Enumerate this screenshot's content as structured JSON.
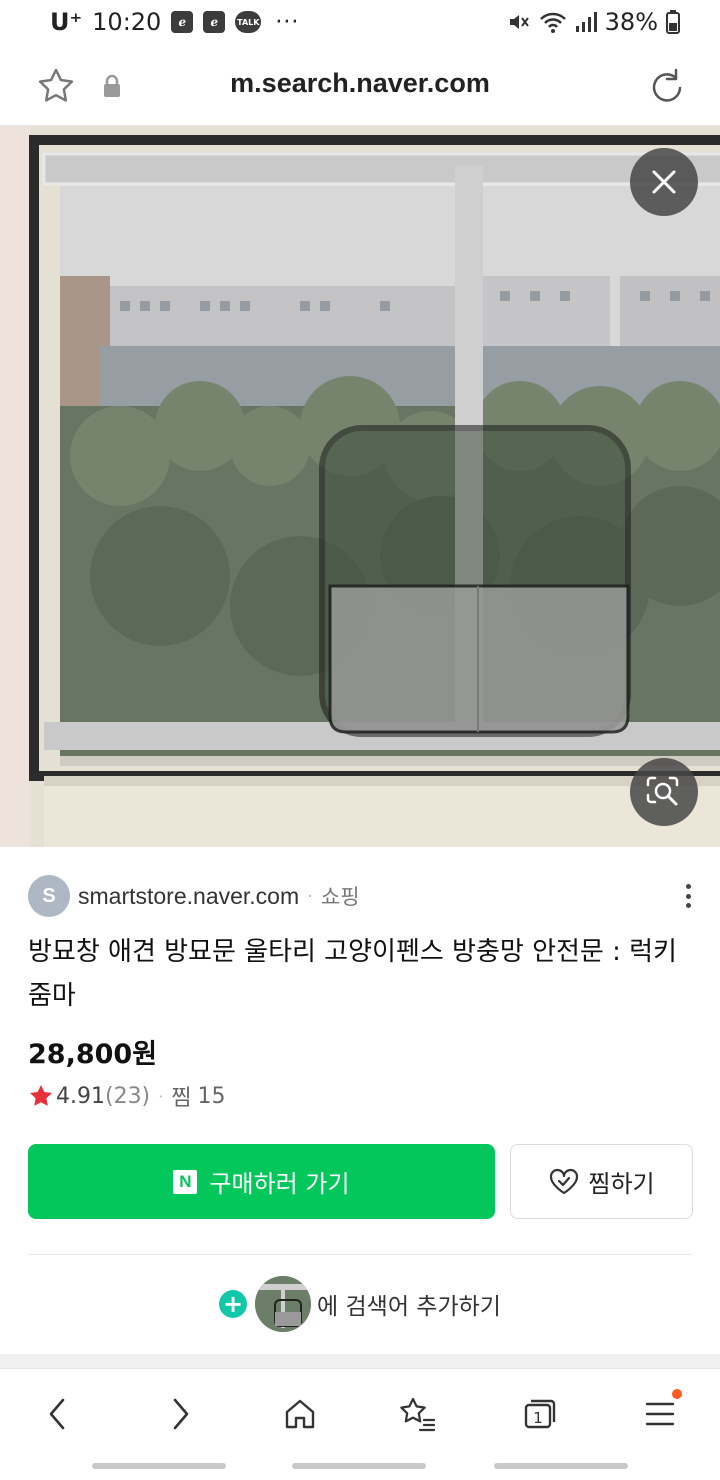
{
  "status_bar": {
    "carrier": "U⁺",
    "time": "10:20",
    "badge_1": "ℯ",
    "badge_2": "ℯ",
    "talk": "TALK",
    "more": "···",
    "battery": "38%"
  },
  "browser": {
    "url": "m.search.naver.com"
  },
  "product": {
    "source_avatar": "S",
    "source_domain": "smartstore.naver.com",
    "source_separator": "·",
    "category": "쇼핑",
    "title": "방묘창 애견 방묘문 울타리 고양이펜스 방충망 안전문 : 럭키줌마",
    "price": "28,800원",
    "rating": "4.91",
    "rating_count": "(23)",
    "stat_separator": "·",
    "wish_label": "찜",
    "wish_count": "15",
    "buy_label": "구매하러 가기",
    "buy_badge": "N",
    "like_label": "찜하기",
    "add_search_text": "에 검색어 추가하기",
    "add_search_plus": "+"
  },
  "bottom_nav": {
    "tab_count": "1"
  },
  "colors": {
    "accent_green": "#03c75a",
    "plus_teal": "#11c9a8",
    "star_red": "#e8303a",
    "notification_dot": "#ff5a1f"
  }
}
